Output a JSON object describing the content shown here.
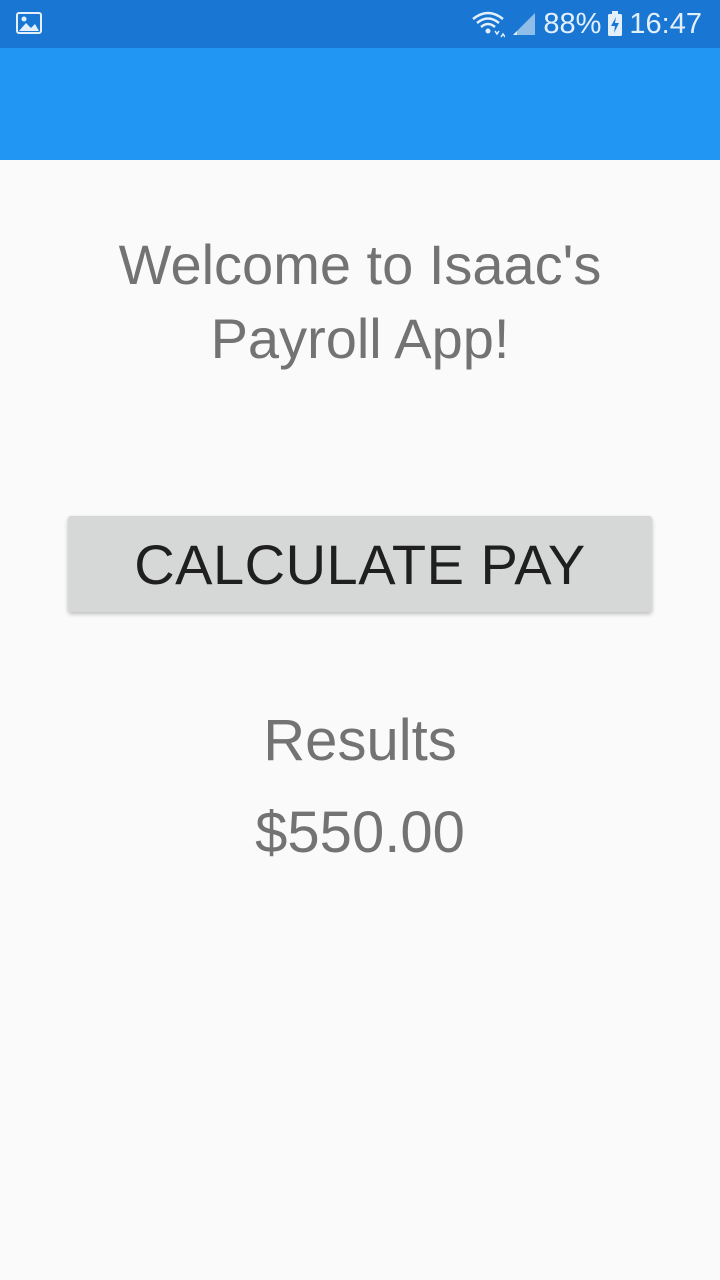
{
  "status_bar": {
    "left_icon": "image-notification-icon",
    "battery": "88%",
    "time": "16:47",
    "icons": [
      "wifi-icon",
      "signal-icon",
      "battery-charging-icon"
    ]
  },
  "app_bar": {
    "color": "#2196f3"
  },
  "main": {
    "welcome_text": "Welcome to Isaac's Payroll App!",
    "calculate_button_label": "CALCULATE PAY",
    "results_label": "Results",
    "results_value": "$550.00"
  },
  "colors": {
    "status_bar": "#1976d2",
    "app_bar": "#2196f3",
    "background": "#fafafa",
    "button": "#d6d7d7",
    "text_secondary": "#737373"
  }
}
